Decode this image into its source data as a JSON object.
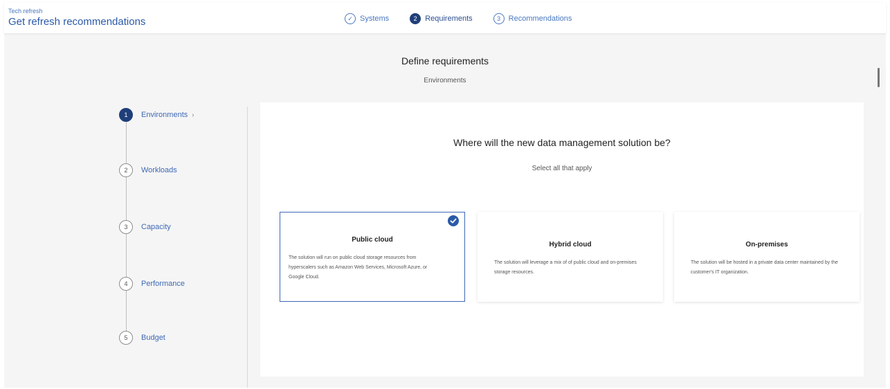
{
  "header": {
    "breadcrumb": "Tech refresh",
    "title": "Get refresh recommendations",
    "steps": [
      {
        "label": "Systems",
        "marker": "✓",
        "state": "done"
      },
      {
        "label": "Requirements",
        "marker": "2",
        "state": "active"
      },
      {
        "label": "Recommendations",
        "marker": "3",
        "state": "pending"
      }
    ]
  },
  "page": {
    "heading": "Define requirements",
    "subheading": "Environments"
  },
  "sidebar": {
    "items": [
      {
        "number": "1",
        "label": "Environments",
        "chevron": "›",
        "current": true
      },
      {
        "number": "2",
        "label": "Workloads"
      },
      {
        "number": "3",
        "label": "Capacity"
      },
      {
        "number": "4",
        "label": "Performance"
      },
      {
        "number": "5",
        "label": "Budget"
      }
    ]
  },
  "main": {
    "question": "Where will the new data management solution be?",
    "hint": "Select all that apply",
    "options": [
      {
        "title": "Public cloud",
        "description": "The solution will run on public cloud storage resources from hyperscalers such as Amazon Web Services, Microsoft Azure, or Google Cloud.",
        "selected": true
      },
      {
        "title": "Hybrid cloud",
        "description": "The solution will leverage a mix of of public cloud and on-premises storage resources.",
        "selected": false
      },
      {
        "title": "On-premises",
        "description": "The solution will be hosted in a private data center maintained by the customer's IT organization.",
        "selected": false
      }
    ]
  },
  "icons": {
    "systems_step": "check-circle-icon",
    "selected_card": "checkmark-badge-icon"
  },
  "colors": {
    "accent": "#2b5aa8",
    "active_step": "#1f3f7a"
  }
}
